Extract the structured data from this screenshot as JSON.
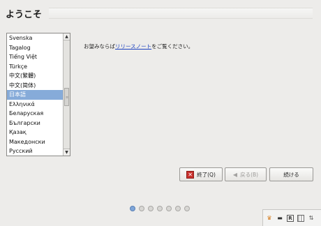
{
  "header": {
    "title": "ようこそ"
  },
  "languages": {
    "items": [
      "Svenska",
      "Tagalog",
      "Tiếng Việt",
      "Türkçe",
      "中文(繁體)",
      "中文(简体)",
      "日本語",
      "Ελληνικά",
      "Беларуская",
      "Български",
      "Қазақ",
      "Македонски",
      "Русский"
    ],
    "selected": "日本語"
  },
  "release_notes": {
    "prefix": "お望みならば",
    "link": "リリースノート",
    "suffix": "をご覧ください。"
  },
  "buttons": {
    "quit": "終了(Q)",
    "back": "戻る(B)",
    "continue": "続ける"
  },
  "progress": {
    "total_steps": 7,
    "current_step": 1
  },
  "tray": {
    "icons": [
      "keyboard-layout-icon",
      "battery-icon",
      "r-icon",
      "grid-icon",
      "network-icon"
    ]
  },
  "colors": {
    "selection": "#86abd9",
    "link": "#1a3fbf",
    "quit_icon": "#c9302c"
  }
}
